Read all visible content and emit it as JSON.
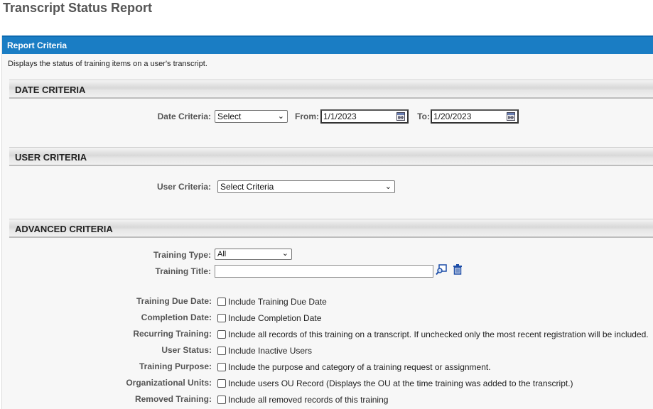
{
  "page": {
    "title": "Transcript Status Report"
  },
  "panel": {
    "header": "Report Criteria",
    "description": "Displays the status of training items on a user's transcript."
  },
  "date_criteria": {
    "section_title": "DATE CRITERIA",
    "label": "Date Criteria:",
    "select_value": "Select",
    "from_label": "From:",
    "from_value": "1/1/2023",
    "to_label": "To:",
    "to_value": "1/20/2023"
  },
  "user_criteria": {
    "section_title": "USER CRITERIA",
    "label": "User Criteria:",
    "select_value": "Select Criteria"
  },
  "advanced_criteria": {
    "section_title": "ADVANCED CRITERIA",
    "training_type_label": "Training Type:",
    "training_type_value": "All",
    "training_title_label": "Training Title:",
    "training_title_value": "",
    "options": [
      {
        "label": "Training Due Date:",
        "text": "Include Training Due Date",
        "checked": false
      },
      {
        "label": "Completion Date:",
        "text": "Include Completion Date",
        "checked": false
      },
      {
        "label": "Recurring Training:",
        "text": "Include all records of this training on a transcript. If unchecked only the most recent registration will be included.",
        "checked": false
      },
      {
        "label": "User Status:",
        "text": "Include Inactive Users",
        "checked": false
      },
      {
        "label": "Training Purpose:",
        "text": "Include the purpose and category of a training request or assignment.",
        "checked": false
      },
      {
        "label": "Organizational Units:",
        "text": "Include users OU Record (Displays the OU at the time training was added to the transcript.)",
        "checked": false
      },
      {
        "label": "Removed Training:",
        "text": "Include all removed records of this training",
        "checked": false
      }
    ]
  },
  "icons": {
    "calendar": "calendar-icon",
    "search": "search-popup-icon",
    "delete": "trash-icon",
    "dropdown": "chevron-down-icon"
  },
  "colors": {
    "header_blue": "#1a7dc4",
    "icon_blue": "#1f4fa8"
  }
}
